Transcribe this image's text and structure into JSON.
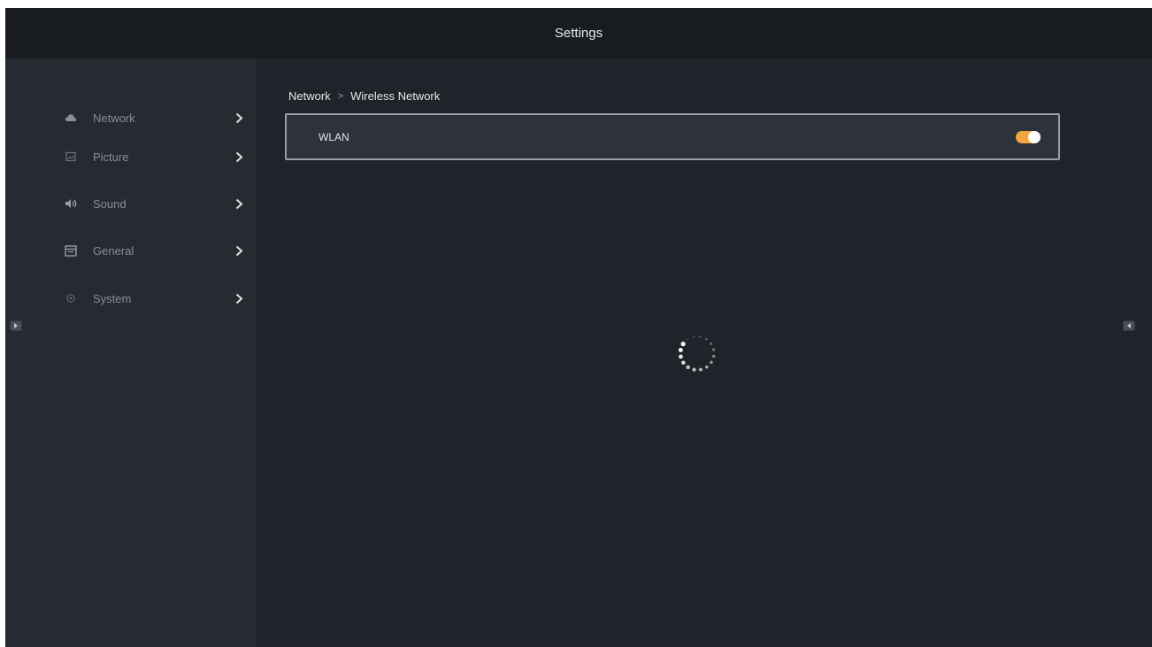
{
  "header": {
    "title": "Settings"
  },
  "sidebar": {
    "items": [
      {
        "label": "Network",
        "icon": "cloud-icon"
      },
      {
        "label": "Picture",
        "icon": "picture-icon"
      },
      {
        "label": "Sound",
        "icon": "speaker-icon"
      },
      {
        "label": "General",
        "icon": "window-icon"
      },
      {
        "label": "System",
        "icon": "system-icon"
      }
    ]
  },
  "breadcrumb": {
    "parent": "Network",
    "separator": ">",
    "current": "Wireless Network"
  },
  "wlan": {
    "label": "WLAN",
    "enabled": true
  },
  "colors": {
    "accent": "#f0a63c",
    "background": "#1f232a",
    "sidebar": "#262a31",
    "titlebar": "#181b1f"
  },
  "status": {
    "loading": true
  }
}
